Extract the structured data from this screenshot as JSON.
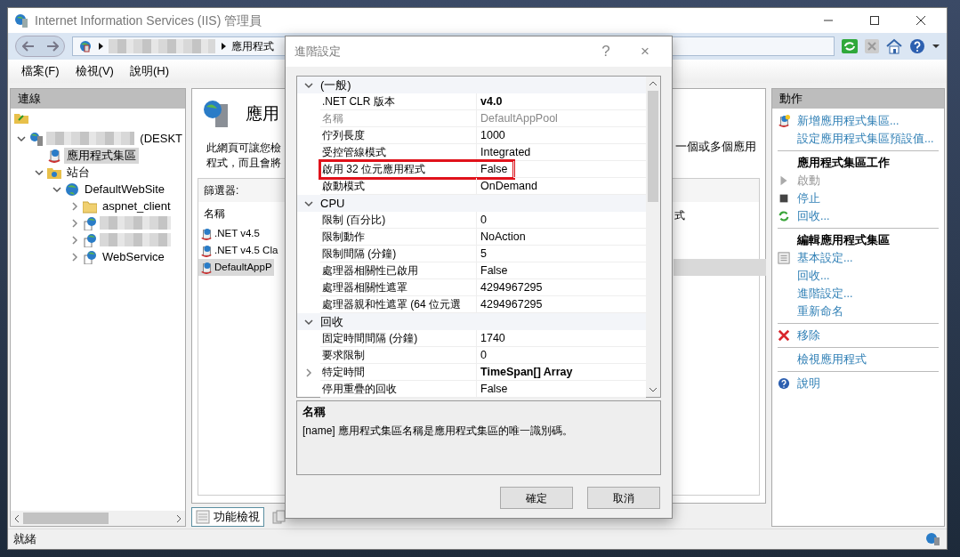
{
  "window": {
    "title": "Internet Information Services (IIS) 管理員"
  },
  "address_bar": {
    "crumbs": [
      {
        "redacted": true
      },
      {
        "label": "應用程式"
      }
    ]
  },
  "menu": [
    "檔案(F)",
    "檢視(V)",
    "說明(H)"
  ],
  "connections": {
    "title": "連線",
    "tree": [
      {
        "kind": "server",
        "label": "(DESKT",
        "redacted": true,
        "expanded": true,
        "selected": false,
        "children": [
          {
            "kind": "pools",
            "label": "應用程式集區",
            "selected": true
          },
          {
            "kind": "sites",
            "label": "站台",
            "expanded": true,
            "selected": false,
            "children": [
              {
                "kind": "site",
                "label": "DefaultWebSite",
                "expanded": true,
                "selected": false,
                "children": [
                  {
                    "kind": "folder",
                    "label": "aspnet_client",
                    "expanded": false,
                    "selected": false
                  },
                  {
                    "kind": "app",
                    "redacted": true,
                    "expanded": false
                  },
                  {
                    "kind": "app",
                    "redacted": true,
                    "expanded": false
                  },
                  {
                    "kind": "app",
                    "label": "WebService",
                    "expanded": false,
                    "selected": false
                  }
                ]
              }
            ]
          }
        ]
      }
    ]
  },
  "feature": {
    "title": "應用",
    "description": [
      "此網頁可讓您檢",
      "程式，而且會將"
    ],
    "description_right": "一個或多個應用",
    "filter_label": "篩選器:",
    "columns": [
      "名稱",
      "式"
    ],
    "rows": [
      {
        "name": ".NET v4.5",
        "selected": false
      },
      {
        "name": ".NET v4.5 Cla",
        "selected": false
      },
      {
        "name": "DefaultAppP",
        "selected": true
      }
    ],
    "view_tabs": [
      {
        "label": "功能檢視",
        "selected": true
      },
      {
        "selected": false
      }
    ]
  },
  "dialog": {
    "title": "進階設定",
    "help": "?",
    "close": "×",
    "grid": [
      {
        "category": "(一般)",
        "expanded": true,
        "rows": [
          {
            "name": ".NET CLR 版本",
            "value": "v4.0",
            "bold": true,
            "disabled": false
          },
          {
            "name": "名稱",
            "value": "DefaultAppPool",
            "bold": false,
            "disabled": true
          },
          {
            "name": "佇列長度",
            "value": "1000",
            "bold": false,
            "disabled": false
          },
          {
            "name": "受控管線模式",
            "value": "Integrated",
            "bold": false,
            "disabled": false
          },
          {
            "name": "啟用 32 位元應用程式",
            "value": "False",
            "bold": false,
            "disabled": false,
            "highlighted": true
          },
          {
            "name": "啟動模式",
            "value": "OnDemand",
            "bold": false,
            "disabled": false
          }
        ]
      },
      {
        "category": "CPU",
        "expanded": true,
        "rows": [
          {
            "name": "限制 (百分比)",
            "value": "0",
            "bold": false,
            "disabled": false
          },
          {
            "name": "限制動作",
            "value": "NoAction",
            "bold": false,
            "disabled": false
          },
          {
            "name": "限制間隔 (分鐘)",
            "value": "5",
            "bold": false,
            "disabled": false
          },
          {
            "name": "處理器相關性已啟用",
            "value": "False",
            "bold": false,
            "disabled": false
          },
          {
            "name": "處理器相關性遮罩",
            "value": "4294967295",
            "bold": false,
            "disabled": false
          },
          {
            "name": "處理器親和性遮罩 (64 位元選",
            "value": "4294967295",
            "bold": false,
            "disabled": false
          }
        ]
      },
      {
        "category": "回收",
        "expanded": true,
        "rows": [
          {
            "name": "固定時間間隔 (分鐘)",
            "value": "1740",
            "bold": false,
            "disabled": false
          },
          {
            "name": "要求限制",
            "value": "0",
            "bold": false,
            "disabled": false
          },
          {
            "name": "特定時間",
            "value": "TimeSpan[] Array",
            "bold": true,
            "disabled": false,
            "expandable": true
          },
          {
            "name": "停用重疊的回收",
            "value": "False",
            "bold": false,
            "disabled": false
          }
        ]
      }
    ],
    "description": {
      "title": "名稱",
      "text": "[name] 應用程式集區名稱是應用程式集區的唯一識別碼。"
    },
    "buttons": [
      "確定",
      "取消"
    ]
  },
  "actions": {
    "title": "動作",
    "groups": [
      [
        {
          "kind": "link",
          "label": "新增應用程式集區...",
          "disabled": false
        },
        {
          "kind": "link",
          "label": "設定應用程式集區預設值...",
          "disabled": false
        }
      ],
      [
        {
          "kind": "heading",
          "label": "應用程式集區工作"
        },
        {
          "kind": "link",
          "label": "啟動",
          "disabled": true
        },
        {
          "kind": "link",
          "label": "停止",
          "disabled": false
        },
        {
          "kind": "link",
          "label": "回收...",
          "disabled": false
        }
      ],
      [
        {
          "kind": "heading",
          "label": "編輯應用程式集區"
        },
        {
          "kind": "link",
          "label": "基本設定...",
          "disabled": false
        },
        {
          "kind": "link",
          "label": "回收...",
          "disabled": false
        },
        {
          "kind": "link",
          "label": "進階設定...",
          "disabled": false
        },
        {
          "kind": "link",
          "label": "重新命名",
          "disabled": false
        }
      ],
      [
        {
          "kind": "link",
          "label": "移除",
          "disabled": false
        }
      ],
      [
        {
          "kind": "link",
          "label": "檢視應用程式",
          "disabled": false
        }
      ],
      [
        {
          "kind": "link",
          "label": "說明",
          "disabled": false
        }
      ]
    ]
  },
  "status_bar": "就緒"
}
